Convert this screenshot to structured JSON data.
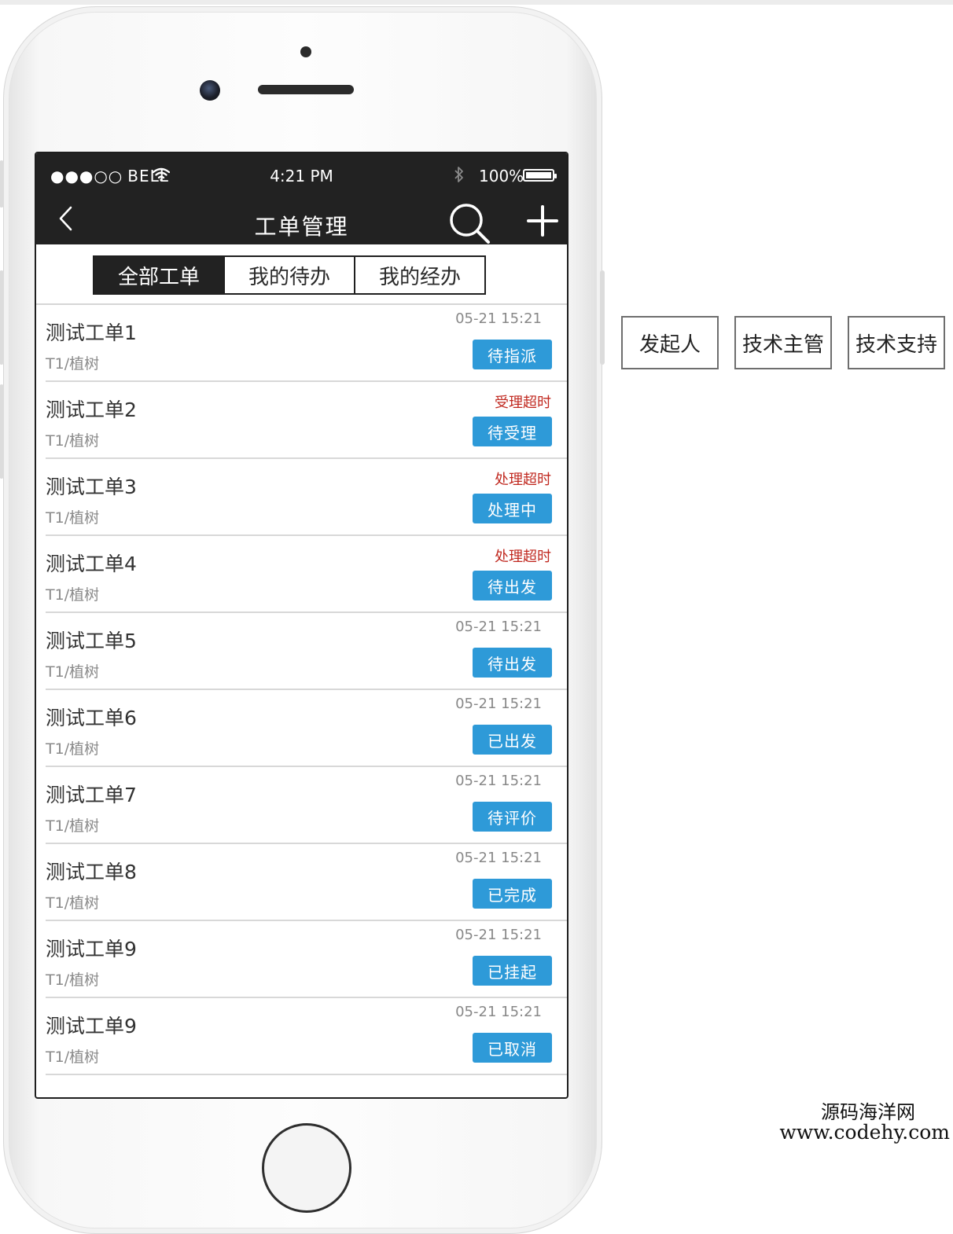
{
  "status_bar": {
    "signal": "●●●○○",
    "carrier": "BELL",
    "time": "4:21 PM",
    "battery": "100%"
  },
  "nav": {
    "title": "工单管理"
  },
  "tabs": [
    {
      "label": "全部工单",
      "active": true
    },
    {
      "label": "我的待办",
      "active": false
    },
    {
      "label": "我的经办",
      "active": false
    }
  ],
  "work_orders": [
    {
      "title": "测试工单1",
      "subtitle": "T1/植树",
      "meta": "05-21 15:21",
      "meta_type": "time",
      "status": "待指派"
    },
    {
      "title": "测试工单2",
      "subtitle": "T1/植树",
      "meta": "受理超时",
      "meta_type": "warning",
      "status": "待受理"
    },
    {
      "title": "测试工单3",
      "subtitle": "T1/植树",
      "meta": "处理超时",
      "meta_type": "warning",
      "status": "处理中"
    },
    {
      "title": "测试工单4",
      "subtitle": "T1/植树",
      "meta": "处理超时",
      "meta_type": "warning",
      "status": "待出发"
    },
    {
      "title": "测试工单5",
      "subtitle": "T1/植树",
      "meta": "05-21 15:21",
      "meta_type": "time",
      "status": "待出发"
    },
    {
      "title": "测试工单6",
      "subtitle": "T1/植树",
      "meta": "05-21 15:21",
      "meta_type": "time",
      "status": "已出发"
    },
    {
      "title": "测试工单7",
      "subtitle": "T1/植树",
      "meta": "05-21 15:21",
      "meta_type": "time",
      "status": "待评价"
    },
    {
      "title": "测试工单8",
      "subtitle": "T1/植树",
      "meta": "05-21 15:21",
      "meta_type": "time",
      "status": "已完成"
    },
    {
      "title": "测试工单9",
      "subtitle": "T1/植树",
      "meta": "05-21 15:21",
      "meta_type": "time",
      "status": "已挂起"
    },
    {
      "title": "测试工单9",
      "subtitle": "T1/植树",
      "meta": "05-21 15:21",
      "meta_type": "time",
      "status": "已取消"
    }
  ],
  "role_buttons": [
    {
      "label": "发起人"
    },
    {
      "label": "技术主管"
    },
    {
      "label": "技术支持"
    }
  ],
  "watermark": {
    "line1": "源码海洋网",
    "line2": "www.codehy.com"
  },
  "colors": {
    "bar_bg": "#222222",
    "status_blue": "#2e9ad8",
    "warning_red": "#c0281f"
  }
}
